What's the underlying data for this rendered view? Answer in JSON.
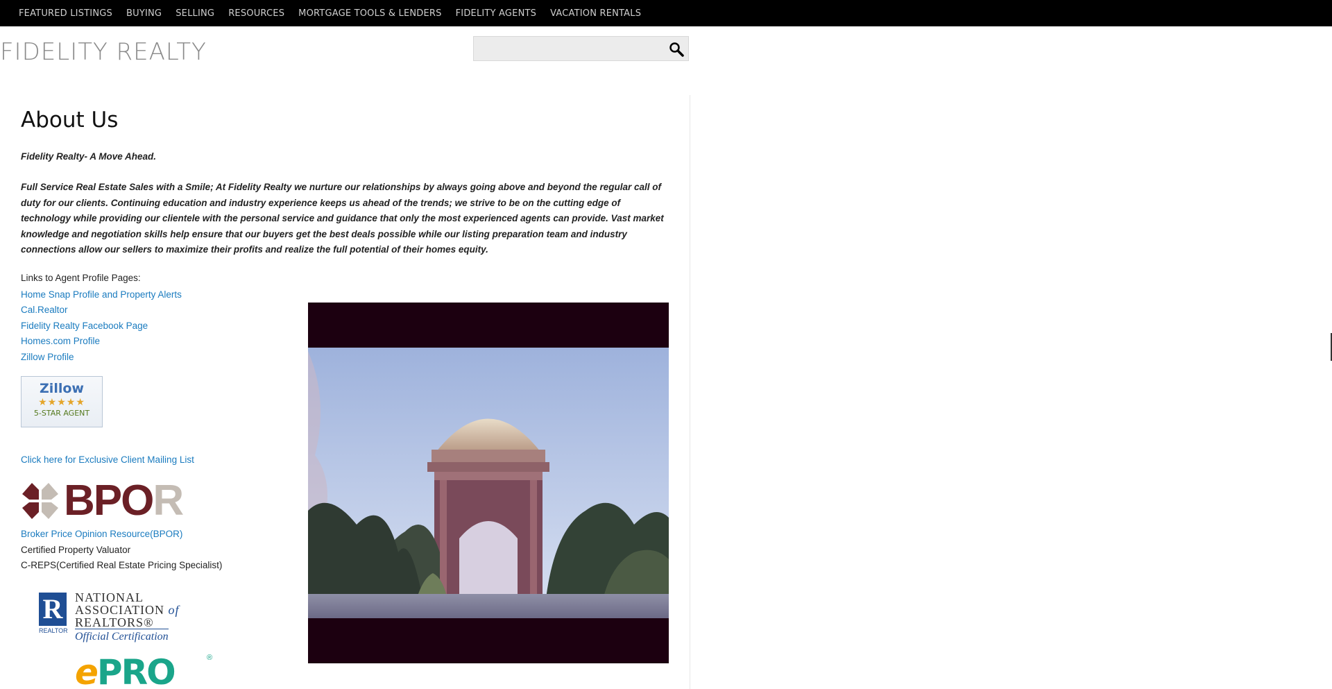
{
  "nav": {
    "items": [
      "FEATURED LISTINGS",
      "BUYING",
      "SELLING",
      "RESOURCES",
      "MORTGAGE TOOLS & LENDERS",
      "FIDELITY AGENTS",
      "VACATION RENTALS"
    ]
  },
  "site": {
    "title": "FIDELITY REALTY"
  },
  "search": {
    "value": "",
    "placeholder": "",
    "icon": "magnifier-icon"
  },
  "main": {
    "title": "About Us",
    "tagline": "Fidelity Realty- A Move Ahead.",
    "intro": "Full Service Real Estate Sales with a Smile; At Fidelity Realty we nurture our relationships by always going above and beyond the regular call of duty for our clients. Continuing education and industry experience keeps us ahead of the trends; we strive to be on the cutting edge of technology while providing our clientele with the personal service and guidance that only the most experienced agents can provide. Vast market knowledge and negotiation skills help ensure that our buyers get the best deals possible while our listing preparation team and industry connections allow our sellers to maximize their profits and realize the full potential of their homes equity.",
    "links_heading": "Links to Agent Profile Pages:",
    "agent_links": [
      "Home Snap Profile and Property Alerts",
      "Cal.Realtor",
      "Fidelity Realty Facebook Page",
      "Homes.com Profile",
      "Zillow Profile"
    ],
    "zillow_badge": {
      "name": "Zillow",
      "stars": "★★★★★",
      "rating": 5,
      "label": "5-STAR AGENT"
    },
    "mailing_link": "Click here for Exclusive Client Mailing List",
    "bpor_logo": {
      "dark": "BPO",
      "light": "R"
    },
    "bpor_link": "Broker Price Opinion Resource(BPOR)",
    "cert_line1": "Certified Property Valuator",
    "cert_line2": "C-REPS(Certified Real Estate Pricing Specialist)",
    "nar_logo": {
      "mark": "R",
      "realtor": "REALTOR",
      "line1": "NATIONAL",
      "line2": "ASSOCIATION",
      "of": "of",
      "line3": "REALTORS®",
      "cert": "Official Certification"
    },
    "epro_logo": {
      "e": "e",
      "pro": "PRO",
      "reg": "®"
    }
  },
  "colors": {
    "nav_bg": "#000000",
    "link": "#1a7bbf",
    "site_title": "#8a8a8a",
    "photo_frame": "#1c0010"
  }
}
